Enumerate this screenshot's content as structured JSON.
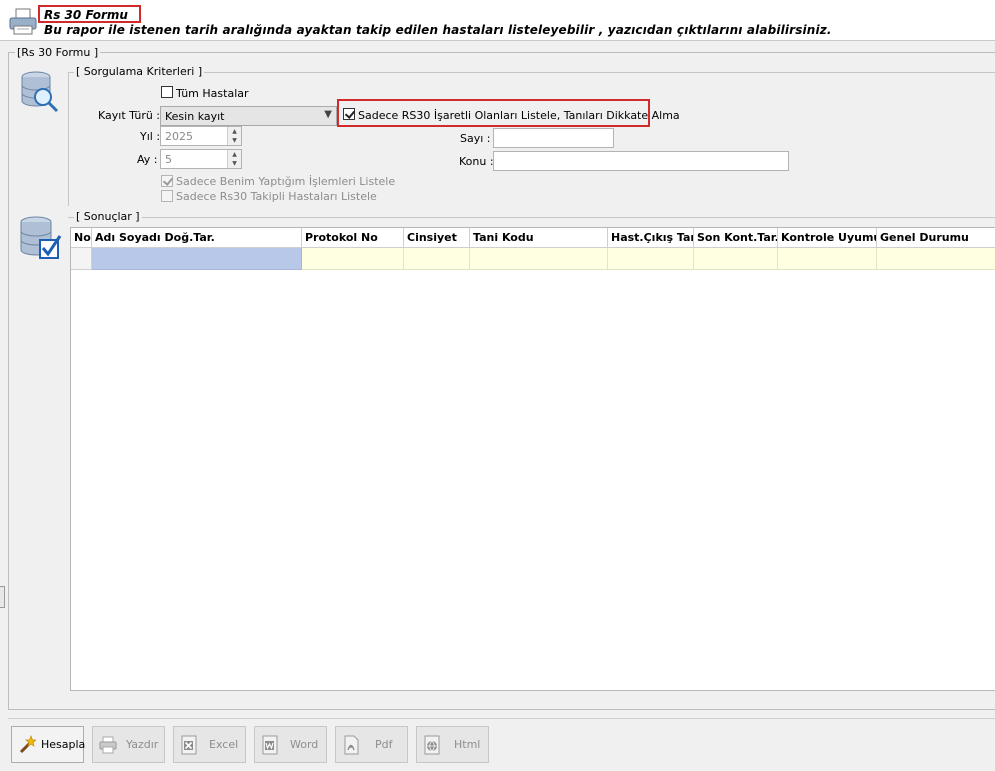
{
  "header": {
    "title": "Rs 30 Formu",
    "subtitle": "Bu rapor ile istenen tarih aralığında ayaktan takip edilen hastaları listeleyebilir ,  yazıcıdan çıktılarını alabilirsiniz."
  },
  "form": {
    "legend": "[Rs 30 Formu ]",
    "criteria_legend": "[ Sorgulama Kriterleri ]",
    "all_patients_label": "Tüm Hastalar",
    "all_patients_checked": false,
    "record_type_label": "Kayıt Türü :",
    "record_type_value": "Kesin kayıt",
    "rs30_only_label": "Sadece RS30 İşaretli Olanları Listele, Tanıları Dikkate Alma",
    "rs30_only_checked": true,
    "year_label": "Yıl :",
    "year_value": "2025",
    "month_label": "Ay :",
    "month_value": "5",
    "count_label": "Sayı :",
    "count_value": "",
    "subject_label": "Konu :",
    "subject_value": "",
    "only_mine_label": "Sadece Benim Yaptığım İşlemleri Listele",
    "only_mine_checked": true,
    "only_rs30_tracked_label": "Sadece Rs30 Takipli Hastaları Listele",
    "only_rs30_tracked_checked": false
  },
  "results": {
    "legend": "[ Sonuçlar  ]",
    "columns": [
      "No",
      "Adı Soyadı Doğ.Tar.",
      "Protokol No",
      "Cinsiyet",
      "Tani Kodu",
      "Hast.Çıkış Tar.",
      "Son Kont.Tar.",
      "Kontrole Uyumu",
      "Genel Durumu"
    ]
  },
  "toolbar": {
    "calculate": "Hesapla",
    "print": "Yazdır",
    "excel": "Excel",
    "word": "Word",
    "pdf": "Pdf",
    "html": "Html"
  },
  "icons": {
    "header": "printer-icon",
    "criteria": "database-search-icon",
    "results": "database-check-icon"
  },
  "colors": {
    "highlight": "#d12a2a",
    "selected_cell": "#b7c8e8",
    "row_fill": "#ffffe1"
  }
}
